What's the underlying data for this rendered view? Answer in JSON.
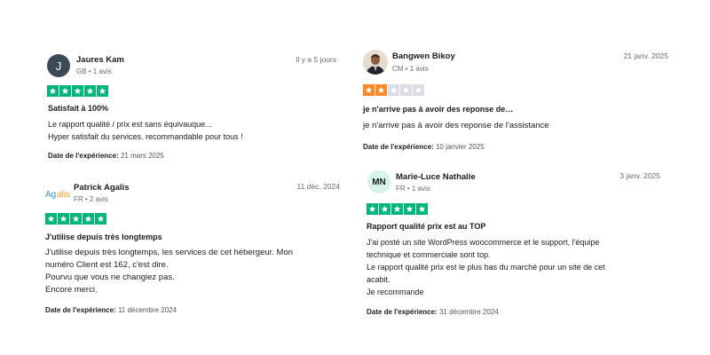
{
  "reviews": [
    {
      "name": "Jaures Kam",
      "meta": "GB • 1 avis",
      "date": "Il y a 5 jours",
      "avatar_letter": "J",
      "rating": 5,
      "title": "Satisfait à 100%",
      "body": [
        "Le rapport qualité / prix est sans équivauque...",
        "Hyper satisfait du services. recommandable pour tous !"
      ],
      "experience_label": "Date de l'expérience:",
      "experience_date": "21 mars 2025"
    },
    {
      "name": "Patrick Agalis",
      "meta": "FR • 2 avis",
      "date": "11 déc. 2024",
      "avatar_logo": "Agalis",
      "rating": 5,
      "title": "J'utilise depuis très longtemps",
      "body": [
        "J'utilise depuis très longtemps, les services de cet hébergeur. Mon",
        "numéro Client est 162, c'est dire.",
        "Pourvu que vous ne changiez pas.",
        "Encore merci."
      ],
      "experience_label": "Date de l'expérience:",
      "experience_date": "11 décembre 2024"
    },
    {
      "name": "Bangwen Bikoy",
      "meta": "CM • 1 avis",
      "date": "21 janv. 2025",
      "rating": 2,
      "title": "je n'arrive pas à avoir des reponse de…",
      "body": [
        "je n'arrive pas à avoir des reponse de l'assistance"
      ],
      "experience_label": "Date de l'expérience:",
      "experience_date": "10 janvier 2025"
    },
    {
      "name": "Marie-Luce Nathalie",
      "meta": "FR • 1 avis",
      "date": "3 janv. 2025",
      "avatar_initials": "MN",
      "rating": 5,
      "title": "Rapport qualité prix est au TOP",
      "body": [
        "J'ai posté un site WordPress woocommerce et le support, l'équipe",
        "technique et commerciale sont top.",
        "Le rapport qualité prix est le plus bas du marché pour un site de cet",
        "acabit.",
        "Je recommande"
      ],
      "experience_label": "Date de l'expérience:",
      "experience_date": "31 décembre 2024"
    }
  ],
  "colors": {
    "star_green": "#00b67a",
    "star_orange": "#ff8622",
    "star_empty": "#dcdce6"
  }
}
